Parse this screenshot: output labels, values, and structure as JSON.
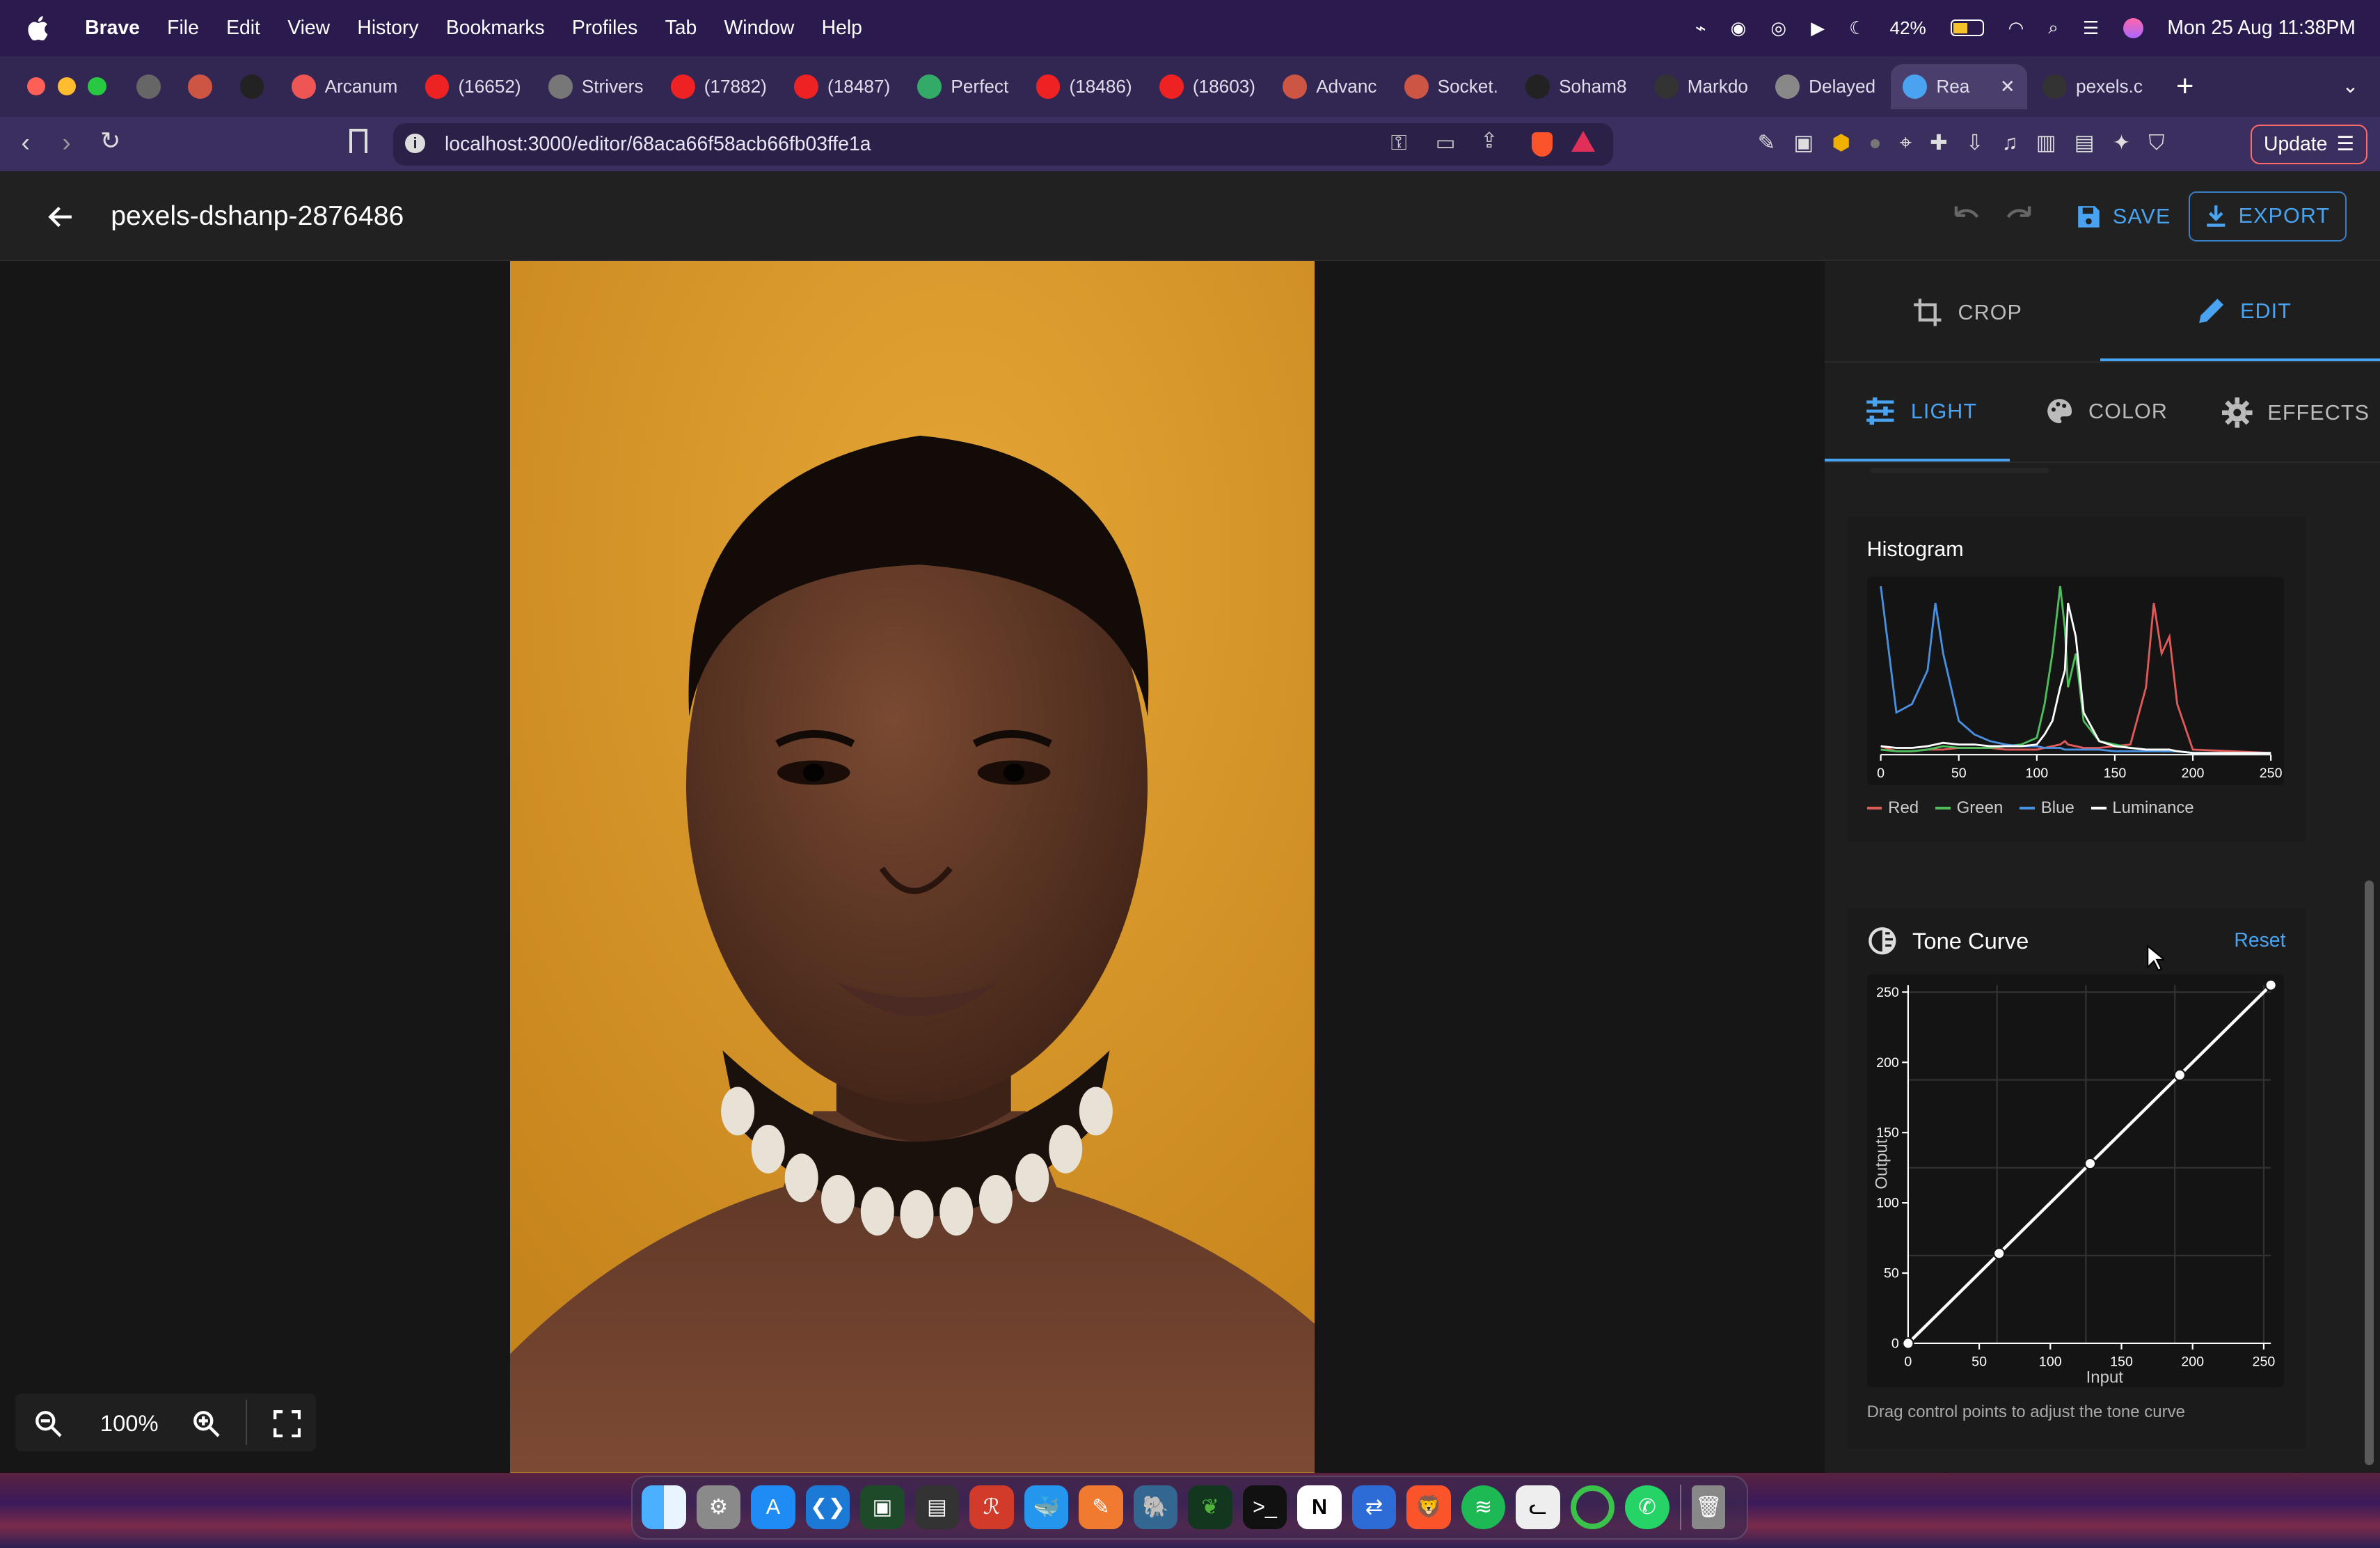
{
  "menubar": {
    "app": "Brave",
    "items": [
      "File",
      "Edit",
      "View",
      "History",
      "Bookmarks",
      "Profiles",
      "Tab",
      "Window",
      "Help"
    ],
    "battery": "42%",
    "datetime": "Mon 25 Aug  11:38PM"
  },
  "tabs": [
    {
      "label": "",
      "color": "#666"
    },
    {
      "label": "",
      "color": "#c54"
    },
    {
      "label": "",
      "color": "#222"
    },
    {
      "label": "Arcanum",
      "color": "#e55"
    },
    {
      "label": "(16652)",
      "color": "#e22"
    },
    {
      "label": "Strivers",
      "color": "#777"
    },
    {
      "label": "(17882)",
      "color": "#e22"
    },
    {
      "label": "(18487)",
      "color": "#e22"
    },
    {
      "label": "Perfect",
      "color": "#3a6"
    },
    {
      "label": "(18486)",
      "color": "#e22"
    },
    {
      "label": "(18603)",
      "color": "#e22"
    },
    {
      "label": "Advanc",
      "color": "#c54"
    },
    {
      "label": "Socket.",
      "color": "#c54"
    },
    {
      "label": "Soham8",
      "color": "#222"
    },
    {
      "label": "Markdo",
      "color": "#333"
    },
    {
      "label": "Delayed",
      "color": "#888"
    },
    {
      "label": "Rea",
      "color": "#4aa3f0"
    },
    {
      "label": "pexels.c",
      "color": "#333"
    }
  ],
  "address": {
    "url": "localhost:3000/editor/68aca66f58acb66fb03ffe1a",
    "update": "Update"
  },
  "app": {
    "title": "pexels-dshanp-2876486",
    "save": "SAVE",
    "export": "EXPORT"
  },
  "panel": {
    "crop": "CROP",
    "edit": "EDIT",
    "light": "LIGHT",
    "color": "COLOR",
    "effects": "EFFECTS"
  },
  "histogram": {
    "title": "Histogram",
    "ticks": [
      "0",
      "50",
      "100",
      "150",
      "200",
      "250"
    ],
    "legend": [
      {
        "name": "Red",
        "color": "#e05a5a"
      },
      {
        "name": "Green",
        "color": "#4cbf5c"
      },
      {
        "name": "Blue",
        "color": "#4a90e0"
      },
      {
        "name": "Luminance",
        "color": "#ffffff"
      }
    ]
  },
  "tone_curve": {
    "title": "Tone Curve",
    "reset": "Reset",
    "xlabel": "Input",
    "ylabel": "Output",
    "ticks": [
      "0",
      "50",
      "100",
      "150",
      "200",
      "250"
    ],
    "hint": "Drag control points to adjust the tone curve"
  },
  "zoom": {
    "level": "100%"
  },
  "chart_data": [
    {
      "type": "line",
      "title": "Histogram",
      "x": [
        0,
        10,
        20,
        30,
        35,
        40,
        50,
        60,
        70,
        80,
        90,
        100,
        105,
        110,
        115,
        118,
        120,
        125,
        130,
        140,
        150,
        160,
        170,
        175,
        180,
        185,
        190,
        200,
        250
      ],
      "series": [
        {
          "name": "Red",
          "values": [
            5,
            2,
            2,
            3,
            3,
            3,
            4,
            4,
            4,
            3,
            3,
            3,
            4,
            5,
            6,
            8,
            6,
            5,
            4,
            4,
            5,
            6,
            40,
            90,
            60,
            70,
            30,
            3,
            1
          ]
        },
        {
          "name": "Green",
          "values": [
            3,
            2,
            2,
            3,
            4,
            5,
            4,
            4,
            4,
            5,
            6,
            10,
            30,
            60,
            100,
            75,
            40,
            60,
            20,
            8,
            6,
            4,
            3,
            3,
            2,
            2,
            2,
            1,
            1
          ]
        },
        {
          "name": "Blue",
          "values": [
            100,
            25,
            30,
            50,
            90,
            60,
            20,
            12,
            8,
            6,
            5,
            5,
            4,
            4,
            4,
            3,
            3,
            3,
            3,
            3,
            2,
            2,
            2,
            2,
            2,
            2,
            2,
            1,
            1
          ]
        },
        {
          "name": "Luminance",
          "values": [
            5,
            4,
            4,
            5,
            6,
            7,
            6,
            6,
            5,
            5,
            5,
            6,
            12,
            20,
            40,
            50,
            90,
            70,
            25,
            8,
            5,
            4,
            3,
            3,
            3,
            3,
            2,
            1,
            1
          ]
        }
      ],
      "xlim": [
        0,
        250
      ]
    },
    {
      "type": "line",
      "title": "Tone Curve",
      "xlabel": "Input",
      "ylabel": "Output",
      "xlim": [
        0,
        255
      ],
      "ylim": [
        0,
        255
      ],
      "x": [
        0,
        64,
        128,
        191,
        255
      ],
      "series": [
        {
          "name": "",
          "values": [
            0,
            64,
            128,
            191,
            255
          ]
        }
      ]
    }
  ]
}
